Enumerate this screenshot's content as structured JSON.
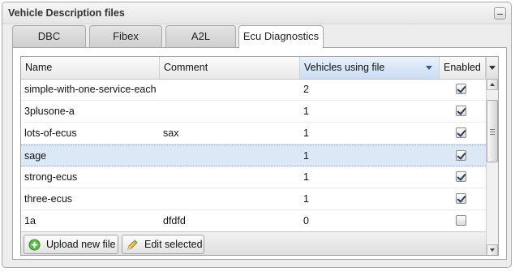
{
  "panel": {
    "title": "Vehicle Description files"
  },
  "tabs": [
    {
      "label": "DBC"
    },
    {
      "label": "Fibex"
    },
    {
      "label": "A2L"
    },
    {
      "label": "Ecu Diagnostics",
      "active": true
    }
  ],
  "grid": {
    "columns": {
      "name": "Name",
      "comment": "Comment",
      "vehicles": "Vehicles using file",
      "enabled": "Enabled"
    },
    "sort": {
      "column": "vehicles",
      "direction": "descending"
    },
    "rows": [
      {
        "name": "simple-with-one-service-each",
        "comment": "",
        "vehicles": "2",
        "enabled": true
      },
      {
        "name": "3plusone-a",
        "comment": "",
        "vehicles": "1",
        "enabled": true
      },
      {
        "name": "lots-of-ecus",
        "comment": "sax",
        "vehicles": "1",
        "enabled": true
      },
      {
        "name": "sage",
        "comment": "",
        "vehicles": "1",
        "enabled": true,
        "selected": true
      },
      {
        "name": "strong-ecus",
        "comment": "",
        "vehicles": "1",
        "enabled": true
      },
      {
        "name": "three-ecus",
        "comment": "",
        "vehicles": "1",
        "enabled": true
      },
      {
        "name": "1a",
        "comment": "dfdfd",
        "vehicles": "0",
        "enabled": false
      }
    ]
  },
  "toolbar": {
    "upload_label": "Upload new file",
    "edit_label": "Edit selected"
  },
  "icons": {
    "upload": "plus-circle-icon",
    "edit": "pencil-icon"
  },
  "colors": {
    "selected_row": "#dde8f6",
    "sorted_header": "#c9ddf4",
    "upload_icon": "#4caf3a"
  }
}
